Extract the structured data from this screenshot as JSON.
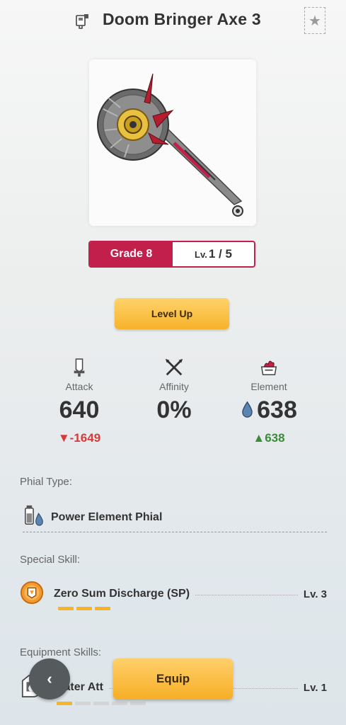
{
  "header": {
    "title": "Doom Bringer Axe 3",
    "weapon_type_icon": "charge-blade-icon",
    "favorite_icon": "star-icon"
  },
  "weapon": {
    "image_icon": "charge-blade-axe-image",
    "grade_label": "Grade 8",
    "level_prefix": "Lv.",
    "level_value": "1 / 5"
  },
  "actions": {
    "level_up_label": "Level Up",
    "equip_label": "Equip",
    "back_icon": "chevron-left-icon"
  },
  "stats": [
    {
      "label": "Attack",
      "value": "640",
      "delta": "-1649",
      "delta_direction": "down",
      "icon": "sword-icon"
    },
    {
      "label": "Affinity",
      "value": "0%",
      "delta": "",
      "delta_direction": "none",
      "icon": "crossed-blades-icon"
    },
    {
      "label": "Element",
      "value": "638",
      "delta": "638",
      "delta_direction": "up",
      "icon": "flame-shield-icon",
      "value_icon": "water-drop-icon"
    }
  ],
  "phial": {
    "section_label": "Phial Type:",
    "name": "Power Element Phial",
    "icon": "phial-water-icon"
  },
  "special_skill": {
    "section_label": "Special Skill:",
    "name": "Zero Sum Discharge (SP)",
    "level": "Lv. 3",
    "level_filled": 3,
    "level_max": 3,
    "icon": "special-skill-icon"
  },
  "equipment_skills": {
    "section_label": "Equipment Skills:",
    "items": [
      {
        "name": "Water Att",
        "level": "Lv. 1",
        "level_filled": 1,
        "level_max": 5,
        "icon": "water-attack-skill-icon"
      }
    ]
  },
  "colors": {
    "grade_red": "#c21f4c",
    "accent_orange": "#f6b22a",
    "negative": "#d63a3a",
    "positive": "#3b8c3a",
    "water_blue": "#5b84b0"
  }
}
